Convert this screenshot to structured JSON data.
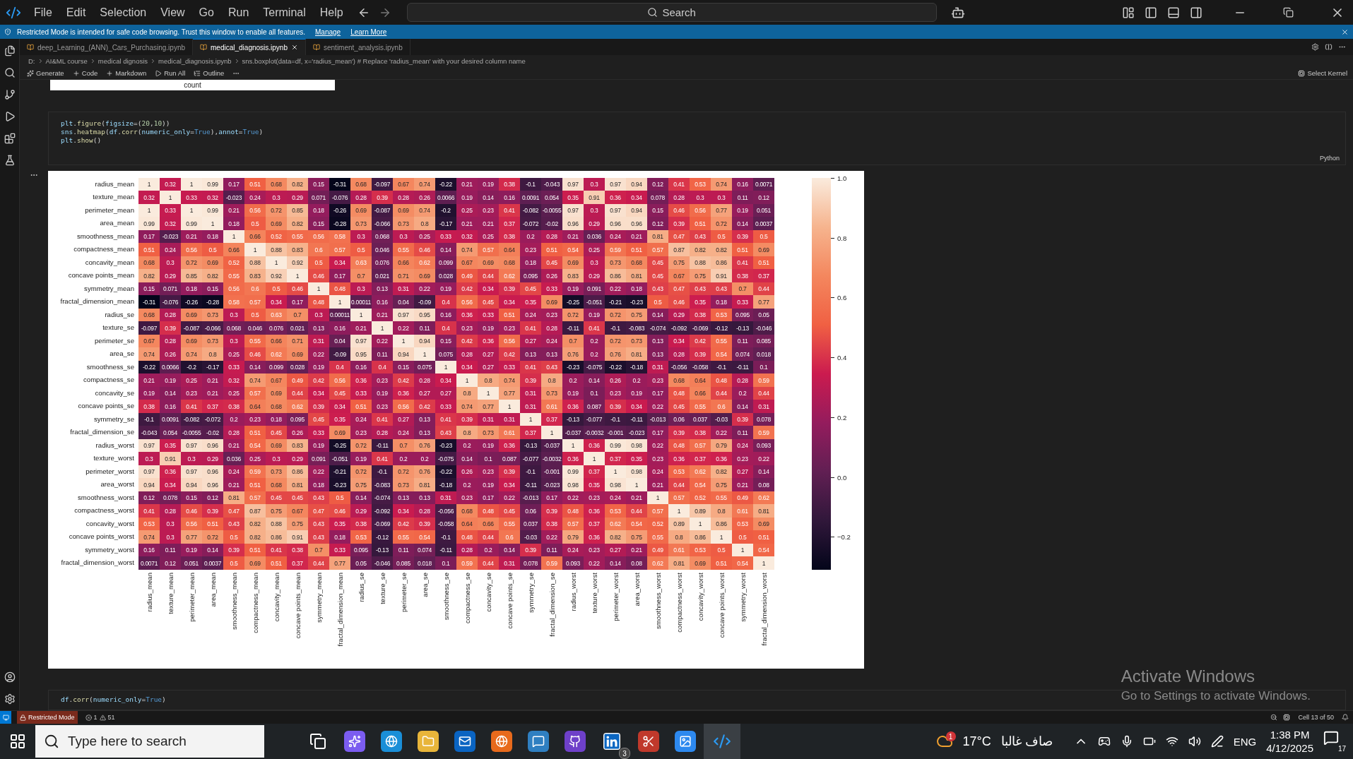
{
  "menu": [
    "File",
    "Edit",
    "Selection",
    "View",
    "Go",
    "Run",
    "Terminal",
    "Help"
  ],
  "search": "Search",
  "banner": {
    "text": "Restricted Mode is intended for safe code browsing. Trust this window to enable all features.",
    "links": [
      "Manage",
      "Learn More"
    ]
  },
  "tabs": [
    {
      "label": "deep_Learning_(ANN)_Cars_Purchasing.ipynb",
      "selected": false
    },
    {
      "label": "medical_diagnosis.ipynb",
      "selected": true
    },
    {
      "label": "sentiment_analysis.ipynb",
      "selected": false
    }
  ],
  "breadcrumb": [
    "D:",
    "AI&ML course",
    "medical dignosis",
    "medical_diagnosis.ipynb",
    "sns.boxplot(data=df, x='radius_mean') # Replace 'radius_mean' with your desired column name"
  ],
  "toolbar": [
    "Generate",
    "Code",
    "Markdown",
    "Run All",
    "Outline"
  ],
  "kernel": "Select Kernel",
  "previous_output": "count",
  "code_cell": {
    "language": "Python",
    "lines": [
      [
        {
          "text": "plt",
          "kind": "var"
        },
        {
          "text": ".",
          "kind": "punc"
        },
        {
          "text": "figure",
          "kind": "fn"
        },
        {
          "text": "(",
          "kind": "punc"
        },
        {
          "text": "figsize",
          "kind": "var"
        },
        {
          "text": "=(",
          "kind": "punc"
        },
        {
          "text": "20",
          "kind": "num"
        },
        {
          "text": ",",
          "kind": "punc"
        },
        {
          "text": "10",
          "kind": "num"
        },
        {
          "text": "))",
          "kind": "punc"
        }
      ],
      [
        {
          "text": "sns",
          "kind": "var"
        },
        {
          "text": ".",
          "kind": "punc"
        },
        {
          "text": "heatmap",
          "kind": "fn"
        },
        {
          "text": "(",
          "kind": "punc"
        },
        {
          "text": "df",
          "kind": "var"
        },
        {
          "text": ".",
          "kind": "punc"
        },
        {
          "text": "corr",
          "kind": "fn"
        },
        {
          "text": "(",
          "kind": "punc"
        },
        {
          "text": "numeric_only",
          "kind": "var"
        },
        {
          "text": "=",
          "kind": "punc"
        },
        {
          "text": "True",
          "kind": "kw"
        },
        {
          "text": "),",
          "kind": "punc"
        },
        {
          "text": "annot",
          "kind": "var"
        },
        {
          "text": "=",
          "kind": "punc"
        },
        {
          "text": "True",
          "kind": "kw"
        },
        {
          "text": ")",
          "kind": "punc"
        }
      ],
      [
        {
          "text": "plt",
          "kind": "var"
        },
        {
          "text": ".",
          "kind": "punc"
        },
        {
          "text": "show",
          "kind": "fn"
        },
        {
          "text": "()",
          "kind": "punc"
        }
      ]
    ]
  },
  "heatmap": {
    "row_labels": [
      "radius_mean",
      "texture_mean",
      "perimeter_mean",
      "area_mean",
      "smoothness_mean",
      "compactness_mean",
      "concavity_mean",
      "concave points_mean",
      "symmetry_mean",
      "fractal_dimension_mean",
      "radius_se",
      "texture_se",
      "perimeter_se",
      "area_se",
      "smoothness_se",
      "compactness_se",
      "concavity_se",
      "concave points_se",
      "symmetry_se",
      "fractal_dimension_se",
      "radius_worst",
      "texture_worst",
      "perimeter_worst",
      "area_worst",
      "smoothness_worst",
      "compactness_worst",
      "concavity_worst",
      "concave points_worst",
      "symmetry_worst",
      "fractal_dimension_worst"
    ],
    "column_labels": [
      "radius_mean",
      "texture_mean",
      "perimeter_mean",
      "area_mean",
      "smoothness_mean",
      "compactness_mean",
      "concavity_mean",
      "concave points_mean",
      "symmetry_mean",
      "fractal_dimension_mean",
      "radius_se",
      "texture_se",
      "perimeter_se",
      "area_se",
      "smoothness_se",
      "compactness_se",
      "concavity_se",
      "concave points_se",
      "symmetry_se",
      "fractal_dimension_se",
      "radius_worst",
      "texture_worst",
      "perimeter_worst",
      "area_worst",
      "smoothness_worst",
      "compactness_worst",
      "concavity_worst",
      "concave points_worst",
      "symmetry_worst",
      "fractal_dimension_worst"
    ],
    "rows": [
      [
        "1",
        "0.32",
        "1",
        "0.99",
        "0.17",
        "0.51",
        "0.68",
        "0.82",
        "0.15",
        "-0.31",
        "0.68",
        "-0.097",
        "0.67",
        "0.74",
        "-0.22",
        "0.21",
        "0.19",
        "0.38",
        "-0.1",
        "-0.043",
        "0.97",
        "0.3",
        "0.97",
        "0.94",
        "0.12",
        "0.41",
        "0.53",
        "0.74",
        "0.16",
        "0.0071"
      ],
      [
        "0.32",
        "1",
        "0.33",
        "0.32",
        "-0.023",
        "0.24",
        "0.3",
        "0.29",
        "0.071",
        "-0.076",
        "0.28",
        "0.39",
        "0.28",
        "0.26",
        "0.0066",
        "0.19",
        "0.14",
        "0.16",
        "0.0091",
        "0.054",
        "0.35",
        "0.91",
        "0.36",
        "0.34",
        "0.078",
        "0.28",
        "0.3",
        "0.3",
        "0.11",
        "0.12"
      ],
      [
        "1",
        "0.33",
        "1",
        "0.99",
        "0.21",
        "0.56",
        "0.72",
        "0.85",
        "0.18",
        "-0.26",
        "0.69",
        "-0.087",
        "0.69",
        "0.74",
        "-0.2",
        "0.25",
        "0.23",
        "0.41",
        "-0.082",
        "-0.0055",
        "0.97",
        "0.3",
        "0.97",
        "0.94",
        "0.15",
        "0.46",
        "0.56",
        "0.77",
        "0.19",
        "0.051"
      ],
      [
        "0.99",
        "0.32",
        "0.99",
        "1",
        "0.18",
        "0.5",
        "0.69",
        "0.82",
        "0.15",
        "-0.28",
        "0.73",
        "-0.066",
        "0.73",
        "0.8",
        "-0.17",
        "0.21",
        "0.21",
        "0.37",
        "-0.072",
        "-0.02",
        "0.96",
        "0.29",
        "0.96",
        "0.96",
        "0.12",
        "0.39",
        "0.51",
        "0.72",
        "0.14",
        "0.0037"
      ],
      [
        "0.17",
        "-0.023",
        "0.21",
        "0.18",
        "1",
        "0.66",
        "0.52",
        "0.55",
        "0.56",
        "0.58",
        "0.3",
        "0.068",
        "0.3",
        "0.25",
        "0.33",
        "0.32",
        "0.25",
        "0.38",
        "0.2",
        "0.28",
        "0.21",
        "0.036",
        "0.24",
        "0.21",
        "0.81",
        "0.47",
        "0.43",
        "0.5",
        "0.39",
        "0.5"
      ],
      [
        "0.51",
        "0.24",
        "0.56",
        "0.5",
        "0.66",
        "1",
        "0.88",
        "0.83",
        "0.6",
        "0.57",
        "0.5",
        "0.046",
        "0.55",
        "0.46",
        "0.14",
        "0.74",
        "0.57",
        "0.64",
        "0.23",
        "0.51",
        "0.54",
        "0.25",
        "0.59",
        "0.51",
        "0.57",
        "0.87",
        "0.82",
        "0.82",
        "0.51",
        "0.69"
      ],
      [
        "0.68",
        "0.3",
        "0.72",
        "0.69",
        "0.52",
        "0.88",
        "1",
        "0.92",
        "0.5",
        "0.34",
        "0.63",
        "0.076",
        "0.66",
        "0.62",
        "0.099",
        "0.67",
        "0.69",
        "0.68",
        "0.18",
        "0.45",
        "0.69",
        "0.3",
        "0.73",
        "0.68",
        "0.45",
        "0.75",
        "0.88",
        "0.86",
        "0.41",
        "0.51"
      ],
      [
        "0.82",
        "0.29",
        "0.85",
        "0.82",
        "0.55",
        "0.83",
        "0.92",
        "1",
        "0.46",
        "0.17",
        "0.7",
        "0.021",
        "0.71",
        "0.69",
        "0.028",
        "0.49",
        "0.44",
        "0.62",
        "0.095",
        "0.26",
        "0.83",
        "0.29",
        "0.86",
        "0.81",
        "0.45",
        "0.67",
        "0.75",
        "0.91",
        "0.38",
        "0.37"
      ],
      [
        "0.15",
        "0.071",
        "0.18",
        "0.15",
        "0.56",
        "0.6",
        "0.5",
        "0.46",
        "1",
        "0.48",
        "0.3",
        "0.13",
        "0.31",
        "0.22",
        "0.19",
        "0.42",
        "0.34",
        "0.39",
        "0.45",
        "0.33",
        "0.19",
        "0.091",
        "0.22",
        "0.18",
        "0.43",
        "0.47",
        "0.43",
        "0.43",
        "0.7",
        "0.44"
      ],
      [
        "-0.31",
        "-0.076",
        "-0.26",
        "-0.28",
        "0.58",
        "0.57",
        "0.34",
        "0.17",
        "0.48",
        "1",
        "0.00011",
        "0.16",
        "0.04",
        "-0.09",
        "0.4",
        "0.56",
        "0.45",
        "0.34",
        "0.35",
        "0.69",
        "-0.25",
        "-0.051",
        "-0.21",
        "-0.23",
        "0.5",
        "0.46",
        "0.35",
        "0.18",
        "0.33",
        "0.77"
      ],
      [
        "0.68",
        "0.28",
        "0.69",
        "0.73",
        "0.3",
        "0.5",
        "0.63",
        "0.7",
        "0.3",
        "0.00011",
        "1",
        "0.21",
        "0.97",
        "0.95",
        "0.16",
        "0.36",
        "0.33",
        "0.51",
        "0.24",
        "0.23",
        "0.72",
        "0.19",
        "0.72",
        "0.75",
        "0.14",
        "0.29",
        "0.38",
        "0.53",
        "0.095",
        "0.05"
      ],
      [
        "-0.097",
        "0.39",
        "-0.087",
        "-0.066",
        "0.068",
        "0.046",
        "0.076",
        "0.021",
        "0.13",
        "0.16",
        "0.21",
        "1",
        "0.22",
        "0.11",
        "0.4",
        "0.23",
        "0.19",
        "0.23",
        "0.41",
        "0.28",
        "-0.11",
        "0.41",
        "-0.1",
        "-0.083",
        "-0.074",
        "-0.092",
        "-0.069",
        "-0.12",
        "-0.13",
        "-0.046"
      ],
      [
        "0.67",
        "0.28",
        "0.69",
        "0.73",
        "0.3",
        "0.55",
        "0.66",
        "0.71",
        "0.31",
        "0.04",
        "0.97",
        "0.22",
        "1",
        "0.94",
        "0.15",
        "0.42",
        "0.36",
        "0.56",
        "0.27",
        "0.24",
        "0.7",
        "0.2",
        "0.72",
        "0.73",
        "0.13",
        "0.34",
        "0.42",
        "0.55",
        "0.11",
        "0.085"
      ],
      [
        "0.74",
        "0.26",
        "0.74",
        "0.8",
        "0.25",
        "0.46",
        "0.62",
        "0.69",
        "0.22",
        "-0.09",
        "0.95",
        "0.11",
        "0.94",
        "1",
        "0.075",
        "0.28",
        "0.27",
        "0.42",
        "0.13",
        "0.13",
        "0.76",
        "0.2",
        "0.76",
        "0.81",
        "0.13",
        "0.28",
        "0.39",
        "0.54",
        "0.074",
        "0.018"
      ],
      [
        "-0.22",
        "0.0066",
        "-0.2",
        "-0.17",
        "0.33",
        "0.14",
        "0.099",
        "0.028",
        "0.19",
        "0.4",
        "0.16",
        "0.4",
        "0.15",
        "0.075",
        "1",
        "0.34",
        "0.27",
        "0.33",
        "0.41",
        "0.43",
        "-0.23",
        "-0.075",
        "-0.22",
        "-0.18",
        "0.31",
        "-0.056",
        "-0.058",
        "-0.1",
        "-0.11",
        "0.1"
      ],
      [
        "0.21",
        "0.19",
        "0.25",
        "0.21",
        "0.32",
        "0.74",
        "0.67",
        "0.49",
        "0.42",
        "0.56",
        "0.36",
        "0.23",
        "0.42",
        "0.28",
        "0.34",
        "1",
        "0.8",
        "0.74",
        "0.39",
        "0.8",
        "0.2",
        "0.14",
        "0.26",
        "0.2",
        "0.23",
        "0.68",
        "0.64",
        "0.48",
        "0.28",
        "0.59"
      ],
      [
        "0.19",
        "0.14",
        "0.23",
        "0.21",
        "0.25",
        "0.57",
        "0.69",
        "0.44",
        "0.34",
        "0.45",
        "0.33",
        "0.19",
        "0.36",
        "0.27",
        "0.27",
        "0.8",
        "1",
        "0.77",
        "0.31",
        "0.73",
        "0.19",
        "0.1",
        "0.23",
        "0.19",
        "0.17",
        "0.48",
        "0.66",
        "0.44",
        "0.2",
        "0.44"
      ],
      [
        "0.38",
        "0.16",
        "0.41",
        "0.37",
        "0.38",
        "0.64",
        "0.68",
        "0.62",
        "0.39",
        "0.34",
        "0.51",
        "0.23",
        "0.56",
        "0.42",
        "0.33",
        "0.74",
        "0.77",
        "1",
        "0.31",
        "0.61",
        "0.36",
        "0.087",
        "0.39",
        "0.34",
        "0.22",
        "0.45",
        "0.55",
        "0.6",
        "0.14",
        "0.31"
      ],
      [
        "-0.1",
        "0.0091",
        "-0.082",
        "-0.072",
        "0.2",
        "0.23",
        "0.18",
        "0.095",
        "0.45",
        "0.35",
        "0.24",
        "0.41",
        "0.27",
        "0.13",
        "0.41",
        "0.39",
        "0.31",
        "0.31",
        "1",
        "0.37",
        "-0.13",
        "-0.077",
        "-0.1",
        "-0.11",
        "-0.013",
        "0.06",
        "0.037",
        "-0.03",
        "0.39",
        "0.078"
      ],
      [
        "-0.043",
        "0.054",
        "-0.0055",
        "-0.02",
        "0.28",
        "0.51",
        "0.45",
        "0.26",
        "0.33",
        "0.69",
        "0.23",
        "0.28",
        "0.24",
        "0.13",
        "0.43",
        "0.8",
        "0.73",
        "0.61",
        "0.37",
        "1",
        "-0.037",
        "-0.0032",
        "-0.001",
        "-0.023",
        "0.17",
        "0.39",
        "0.38",
        "0.22",
        "0.11",
        "0.59"
      ],
      [
        "0.97",
        "0.35",
        "0.97",
        "0.96",
        "0.21",
        "0.54",
        "0.69",
        "0.83",
        "0.19",
        "-0.25",
        "0.72",
        "-0.11",
        "0.7",
        "0.76",
        "-0.23",
        "0.2",
        "0.19",
        "0.36",
        "-0.13",
        "-0.037",
        "1",
        "0.36",
        "0.99",
        "0.98",
        "0.22",
        "0.48",
        "0.57",
        "0.79",
        "0.24",
        "0.093"
      ],
      [
        "0.3",
        "0.91",
        "0.3",
        "0.29",
        "0.036",
        "0.25",
        "0.3",
        "0.29",
        "0.091",
        "-0.051",
        "0.19",
        "0.41",
        "0.2",
        "0.2",
        "-0.075",
        "0.14",
        "0.1",
        "0.087",
        "-0.077",
        "-0.0032",
        "0.36",
        "1",
        "0.37",
        "0.35",
        "0.23",
        "0.36",
        "0.37",
        "0.36",
        "0.23",
        "0.22"
      ],
      [
        "0.97",
        "0.36",
        "0.97",
        "0.96",
        "0.24",
        "0.59",
        "0.73",
        "0.86",
        "0.22",
        "-0.21",
        "0.72",
        "-0.1",
        "0.72",
        "0.76",
        "-0.22",
        "0.26",
        "0.23",
        "0.39",
        "-0.1",
        "-0.001",
        "0.99",
        "0.37",
        "1",
        "0.98",
        "0.24",
        "0.53",
        "0.62",
        "0.82",
        "0.27",
        "0.14"
      ],
      [
        "0.94",
        "0.34",
        "0.94",
        "0.96",
        "0.21",
        "0.51",
        "0.68",
        "0.81",
        "0.18",
        "-0.23",
        "0.75",
        "-0.083",
        "0.73",
        "0.81",
        "-0.18",
        "0.2",
        "0.19",
        "0.34",
        "-0.11",
        "-0.023",
        "0.98",
        "0.35",
        "0.98",
        "1",
        "0.21",
        "0.44",
        "0.54",
        "0.75",
        "0.21",
        "0.08"
      ],
      [
        "0.12",
        "0.078",
        "0.15",
        "0.12",
        "0.81",
        "0.57",
        "0.45",
        "0.45",
        "0.43",
        "0.5",
        "0.14",
        "-0.074",
        "0.13",
        "0.13",
        "0.31",
        "0.23",
        "0.17",
        "0.22",
        "-0.013",
        "0.17",
        "0.22",
        "0.23",
        "0.24",
        "0.21",
        "1",
        "0.57",
        "0.52",
        "0.55",
        "0.49",
        "0.62"
      ],
      [
        "0.41",
        "0.28",
        "0.46",
        "0.39",
        "0.47",
        "0.87",
        "0.75",
        "0.67",
        "0.47",
        "0.46",
        "0.29",
        "-0.092",
        "0.34",
        "0.28",
        "-0.056",
        "0.68",
        "0.48",
        "0.45",
        "0.06",
        "0.39",
        "0.48",
        "0.36",
        "0.53",
        "0.44",
        "0.57",
        "1",
        "0.89",
        "0.8",
        "0.61",
        "0.81"
      ],
      [
        "0.53",
        "0.3",
        "0.56",
        "0.51",
        "0.43",
        "0.82",
        "0.88",
        "0.75",
        "0.43",
        "0.35",
        "0.38",
        "-0.069",
        "0.42",
        "0.39",
        "-0.058",
        "0.64",
        "0.66",
        "0.55",
        "0.037",
        "0.38",
        "0.57",
        "0.37",
        "0.62",
        "0.54",
        "0.52",
        "0.89",
        "1",
        "0.86",
        "0.53",
        "0.69"
      ],
      [
        "0.74",
        "0.3",
        "0.77",
        "0.72",
        "0.5",
        "0.82",
        "0.86",
        "0.91",
        "0.43",
        "0.18",
        "0.53",
        "-0.12",
        "0.55",
        "0.54",
        "-0.1",
        "0.48",
        "0.44",
        "0.6",
        "-0.03",
        "0.22",
        "0.79",
        "0.36",
        "0.82",
        "0.75",
        "0.55",
        "0.8",
        "0.86",
        "1",
        "0.5",
        "0.51"
      ],
      [
        "0.16",
        "0.11",
        "0.19",
        "0.14",
        "0.39",
        "0.51",
        "0.41",
        "0.38",
        "0.7",
        "0.33",
        "0.095",
        "-0.13",
        "0.11",
        "0.074",
        "-0.11",
        "0.28",
        "0.2",
        "0.14",
        "0.39",
        "0.11",
        "0.24",
        "0.23",
        "0.27",
        "0.21",
        "0.49",
        "0.61",
        "0.53",
        "0.5",
        "1",
        "0.54"
      ],
      [
        "0.0071",
        "0.12",
        "0.051",
        "0.0037",
        "0.5",
        "0.69",
        "0.51",
        "0.37",
        "0.44",
        "0.77",
        "0.05",
        "-0.046",
        "0.085",
        "0.018",
        "0.1",
        "0.59",
        "0.44",
        "0.31",
        "0.078",
        "0.59",
        "0.093",
        "0.22",
        "0.14",
        "0.08",
        "0.62",
        "0.81",
        "0.69",
        "0.51",
        "0.54",
        "1"
      ]
    ],
    "colorbar_ticks": [
      "1.0",
      "0.8",
      "0.6",
      "0.4",
      "0.2",
      "0.0",
      "−0.2"
    ]
  },
  "next_cell": {
    "lines": [
      [
        {
          "text": "df",
          "kind": "var"
        },
        {
          "text": ".",
          "kind": "punc"
        },
        {
          "text": "corr",
          "kind": "fn"
        },
        {
          "text": "(",
          "kind": "punc"
        },
        {
          "text": "numeric_only",
          "kind": "var"
        },
        {
          "text": "=",
          "kind": "punc"
        },
        {
          "text": "True",
          "kind": "kw"
        },
        {
          "text": ")",
          "kind": "punc"
        }
      ]
    ]
  },
  "activation": {
    "title": "Activate Windows",
    "subtitle": "Go to Settings to activate Windows."
  },
  "status_bar": {
    "mode": "Restricted Mode",
    "errors": "1",
    "warnings": "51",
    "cell": "Cell 13 of 50"
  },
  "taskbar": {
    "search_placeholder": "Type here to search",
    "linkedin_badge": "3",
    "weather_badge": "1",
    "temperature": "17°C",
    "weather": "صاف غالبا",
    "language": "ENG",
    "time": "1:38 PM",
    "date": "4/12/2025",
    "notifications": "17"
  }
}
